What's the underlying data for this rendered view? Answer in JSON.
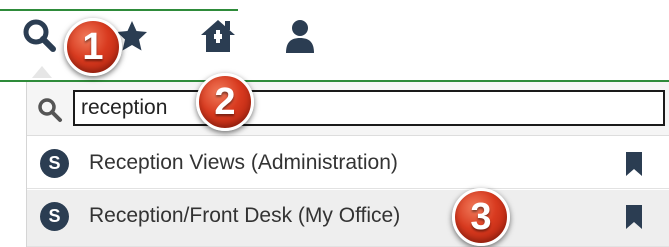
{
  "toolbar": {
    "buttons": [
      {
        "name": "search",
        "icon": "search-icon"
      },
      {
        "name": "favorites",
        "icon": "star-icon"
      },
      {
        "name": "home",
        "icon": "home-icon"
      },
      {
        "name": "user",
        "icon": "user-icon"
      }
    ],
    "accent_color": "#2e8b3a"
  },
  "search": {
    "value": "reception",
    "icon": "search-icon"
  },
  "results": [
    {
      "badge": "S",
      "label": "Reception Views (Administration)",
      "icon": "bookmark-icon"
    },
    {
      "badge": "S",
      "label": "Reception/Front Desk (My Office)",
      "icon": "bookmark-icon"
    }
  ],
  "callouts": [
    "1",
    "2",
    "3"
  ],
  "colors": {
    "badge": "#2b3d52",
    "callout": "#d83a1f",
    "highlight_row": "#eeeeee"
  }
}
